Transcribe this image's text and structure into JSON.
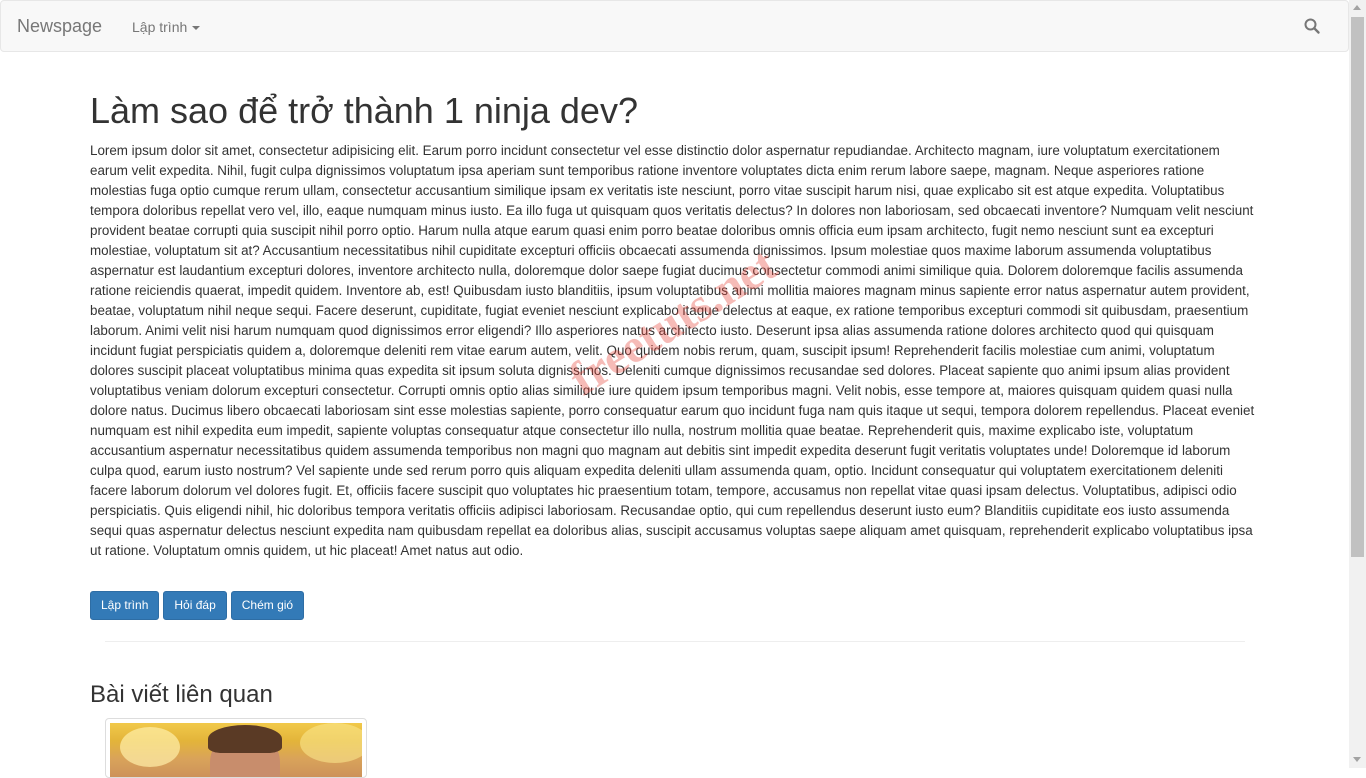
{
  "navbar": {
    "brand": "Newspage",
    "dropdown_label": "Lập trình",
    "search_icon": "search-icon"
  },
  "article": {
    "title": "Làm sao để trở thành 1 ninja dev?",
    "body": "Lorem ipsum dolor sit amet, consectetur adipisicing elit. Earum porro incidunt consectetur vel esse distinctio dolor aspernatur repudiandae. Architecto magnam, iure voluptatum exercitationem earum velit expedita. Nihil, fugit culpa dignissimos voluptatum ipsa aperiam sunt temporibus ratione inventore voluptates dicta enim rerum labore saepe, magnam. Neque asperiores ratione molestias fuga optio cumque rerum ullam, consectetur accusantium similique ipsam ex veritatis iste nesciunt, porro vitae suscipit harum nisi, quae explicabo sit est atque expedita. Voluptatibus tempora doloribus repellat vero vel, illo, eaque numquam minus iusto. Ea illo fuga ut quisquam quos veritatis delectus? In dolores non laboriosam, sed obcaecati inventore? Numquam velit nesciunt provident beatae corrupti quia suscipit nihil porro optio. Harum nulla atque earum quasi enim porro beatae doloribus omnis officia eum ipsam architecto, fugit nemo nesciunt sunt ea excepturi molestiae, voluptatum sit at? Accusantium necessitatibus nihil cupiditate excepturi officiis obcaecati assumenda dignissimos. Ipsum molestiae quos maxime laborum assumenda voluptatibus aspernatur est laudantium excepturi dolores, inventore architecto nulla, doloremque dolor saepe fugiat ducimus consectetur commodi animi similique quia. Dolorem doloremque facilis assumenda ratione reiciendis quaerat, impedit quidem. Inventore ab, est! Quibusdam iusto blanditiis, ipsum voluptatibus animi mollitia maiores magnam minus sapiente error natus aspernatur autem provident, beatae, voluptatum nihil neque sequi. Facere deserunt, cupiditate, fugiat eveniet nesciunt explicabo itaque delectus at eaque, ex ratione temporibus excepturi commodi sit quibusdam, praesentium laborum. Animi velit nisi harum numquam quod dignissimos error eligendi? Illo asperiores natus architecto iusto. Deserunt ipsa alias assumenda ratione dolores architecto quod qui quisquam incidunt fugiat perspiciatis quidem a, doloremque deleniti rem vitae earum autem, velit. Quo quidem nobis rerum, quam, suscipit ipsum! Reprehenderit facilis molestiae cum animi, voluptatum dolores suscipit placeat voluptatibus minima quas expedita sit ipsum soluta dignissimos. Deleniti cumque dignissimos recusandae sed dolores. Placeat sapiente quo animi ipsum alias provident voluptatibus veniam dolorum excepturi consectetur. Corrupti omnis optio alias similique iure quidem ipsum temporibus magni. Velit nobis, esse tempore at, maiores quisquam quidem quasi nulla dolore natus. Ducimus libero obcaecati laboriosam sint esse molestias sapiente, porro consequatur earum quo incidunt fuga nam quis itaque ut sequi, tempora dolorem repellendus. Placeat eveniet numquam est nihil expedita eum impedit, sapiente voluptas consequatur atque consectetur illo nulla, nostrum mollitia quae beatae. Reprehenderit quis, maxime explicabo iste, voluptatum accusantium aspernatur necessitatibus quidem assumenda temporibus non magni quo magnam aut debitis sint impedit expedita deserunt fugit veritatis voluptates unde! Doloremque id laborum culpa quod, earum iusto nostrum? Vel sapiente unde sed rerum porro quis aliquam expedita deleniti ullam assumenda quam, optio. Incidunt consequatur qui voluptatem exercitationem deleniti facere laborum dolorum vel dolores fugit. Et, officiis facere suscipit quo voluptates hic praesentium totam, tempore, accusamus non repellat vitae quasi ipsam delectus. Voluptatibus, adipisci odio perspiciatis. Quis eligendi nihil, hic doloribus tempora veritatis officiis adipisci laboriosam. Recusandae optio, qui cum repellendus deserunt iusto eum? Blanditiis cupiditate eos iusto assumenda sequi quas aspernatur delectus nesciunt expedita nam quibusdam repellat ea doloribus alias, suscipit accusamus voluptas saepe aliquam amet quisquam, reprehenderit explicabo voluptatibus ipsa ut ratione. Voluptatum omnis quidem, ut hic placeat! Amet natus aut odio.",
    "tags": [
      {
        "label": "Lập trình"
      },
      {
        "label": "Hỏi đáp"
      },
      {
        "label": "Chém gió"
      }
    ]
  },
  "related": {
    "title": "Bài viết liên quan"
  },
  "watermark": {
    "text": "freetuts.net"
  },
  "colors": {
    "primary_button": "#337ab7",
    "navbar_bg": "#f8f8f8",
    "text": "#333333",
    "muted": "#777777",
    "watermark": "#e63c32"
  }
}
